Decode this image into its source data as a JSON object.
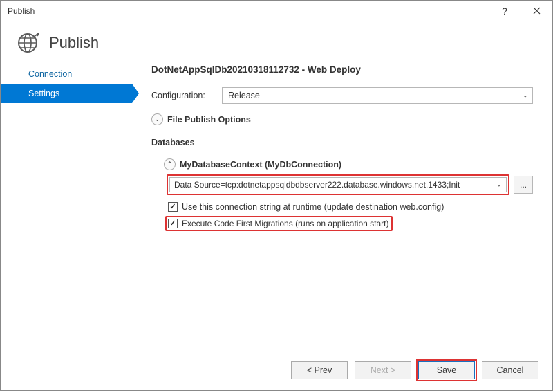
{
  "window": {
    "title": "Publish"
  },
  "header": {
    "title": "Publish"
  },
  "sidebar": {
    "items": [
      {
        "label": "Connection"
      },
      {
        "label": "Settings"
      }
    ]
  },
  "main": {
    "profile_title": "DotNetAppSqlDb20210318112732 - Web Deploy",
    "config_label": "Configuration:",
    "config_value": "Release",
    "file_publish_label": "File Publish Options",
    "databases_label": "Databases",
    "db": {
      "context_label": "MyDatabaseContext (MyDbConnection)",
      "conn_string": "Data Source=tcp:dotnetappsqldbdbserver222.database.windows.net,1433;Init",
      "ellipsis_label": "...",
      "use_conn_label": "Use this connection string at runtime (update destination web.config)",
      "exec_migrations_label": "Execute Code First Migrations (runs on application start)"
    }
  },
  "footer": {
    "prev": "< Prev",
    "next": "Next >",
    "save": "Save",
    "cancel": "Cancel"
  }
}
